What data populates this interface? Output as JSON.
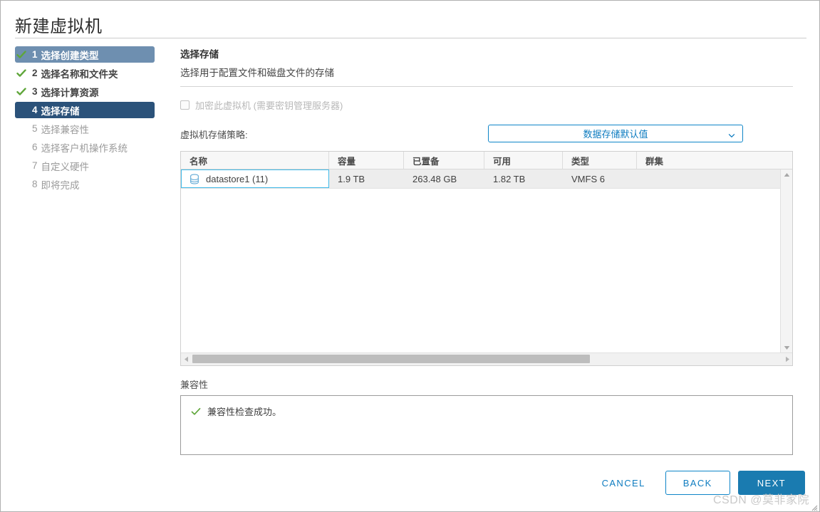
{
  "window": {
    "title": "新建虚拟机"
  },
  "sidebar": {
    "steps": [
      {
        "num": "1",
        "label": "选择创建类型",
        "state": "done-hovered"
      },
      {
        "num": "2",
        "label": "选择名称和文件夹",
        "state": "done"
      },
      {
        "num": "3",
        "label": "选择计算资源",
        "state": "done"
      },
      {
        "num": "4",
        "label": "选择存储",
        "state": "active"
      },
      {
        "num": "5",
        "label": "选择兼容性",
        "state": "pending"
      },
      {
        "num": "6",
        "label": "选择客户机操作系统",
        "state": "pending"
      },
      {
        "num": "7",
        "label": "自定义硬件",
        "state": "pending"
      },
      {
        "num": "8",
        "label": "即将完成",
        "state": "pending"
      }
    ]
  },
  "pane": {
    "title": "选择存储",
    "subtitle": "选择用于配置文件和磁盘文件的存储"
  },
  "encrypt": {
    "label": "加密此虚拟机 (需要密钥管理服务器)",
    "checked": false,
    "disabled": true
  },
  "storage_policy": {
    "label": "虚拟机存储策略:",
    "value": "数据存储默认值",
    "icon": "chevron-down-icon"
  },
  "table": {
    "columns": [
      "名称",
      "容量",
      "已置备",
      "可用",
      "类型",
      "群集"
    ],
    "rows": [
      {
        "name": "datastore1 (11)",
        "capacity": "1.9 TB",
        "provisioned": "263.48 GB",
        "free": "1.82 TB",
        "type": "VMFS 6",
        "cluster": "",
        "icon": "datastore-icon",
        "selected": true
      }
    ]
  },
  "compatibility": {
    "label": "兼容性",
    "message": "兼容性检查成功。",
    "status_icon": "check-icon"
  },
  "footer": {
    "cancel_label": "CANCEL",
    "back_label": "BACK",
    "next_label": "NEXT"
  },
  "watermark": {
    "text": "CSDN @莫非家院"
  },
  "colors": {
    "accent": "#0e7cc0",
    "primary_button": "#1a7bb0",
    "active_step": "#2b527a",
    "hovered_step": "#6e8fb0",
    "success_green": "#5fa63a",
    "selection_border": "#3fb9e8"
  }
}
